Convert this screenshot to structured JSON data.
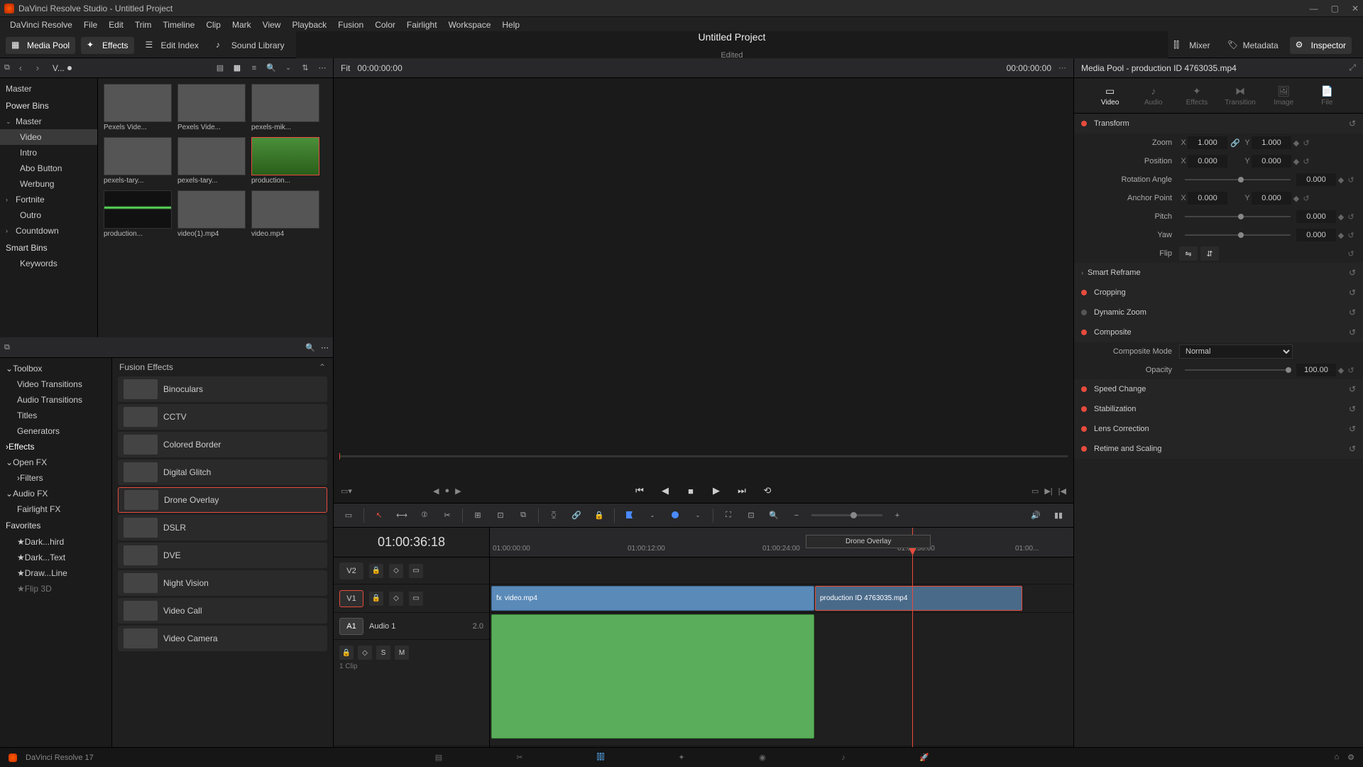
{
  "window": {
    "title": "DaVinci Resolve Studio - Untitled Project"
  },
  "menu": [
    "DaVinci Resolve",
    "File",
    "Edit",
    "Trim",
    "Timeline",
    "Clip",
    "Mark",
    "View",
    "Playback",
    "Fusion",
    "Color",
    "Fairlight",
    "Workspace",
    "Help"
  ],
  "toolbar": {
    "media_pool": "Media Pool",
    "effects": "Effects",
    "edit_index": "Edit Index",
    "sound_library": "Sound Library",
    "project_title": "Untitled Project",
    "edited_badge": "Edited",
    "mixer": "Mixer",
    "metadata": "Metadata",
    "inspector": "Inspector"
  },
  "media_pool": {
    "fit_label": "Fit",
    "viewer_tc": "00:00:00:00",
    "right_tc": "00:00:00:00",
    "selector": "V...",
    "tree": {
      "master": "Master",
      "power_bins": "Power Bins",
      "pb_master": "Master",
      "pb_video": "Video",
      "pb_intro": "Intro",
      "pb_abo": "Abo Button",
      "pb_werbung": "Werbung",
      "pb_fortnite": "Fortnite",
      "pb_outro": "Outro",
      "pb_countdown": "Countdown",
      "smart_bins": "Smart Bins",
      "sb_keywords": "Keywords"
    },
    "clips": [
      {
        "label": "Pexels Vide..."
      },
      {
        "label": "Pexels Vide..."
      },
      {
        "label": "pexels-mik..."
      },
      {
        "label": "pexels-tary..."
      },
      {
        "label": "pexels-tary..."
      },
      {
        "label": "production..."
      },
      {
        "label": "production..."
      },
      {
        "label": "video(1).mp4"
      },
      {
        "label": "video.mp4"
      }
    ]
  },
  "effects": {
    "tree": {
      "toolbox": "Toolbox",
      "vt": "Video Transitions",
      "at": "Audio Transitions",
      "titles": "Titles",
      "generators": "Generators",
      "effects": "Effects",
      "openfx": "Open FX",
      "filters": "Filters",
      "audiofx": "Audio FX",
      "fairlightfx": "Fairlight FX",
      "favorites": "Favorites",
      "fav1": "Dark...hird",
      "fav2": "Dark...Text",
      "fav3": "Draw...Line",
      "fav4": "Flip 3D"
    },
    "category": "Fusion Effects",
    "items": [
      "Binoculars",
      "CCTV",
      "Colored Border",
      "Digital Glitch",
      "Drone Overlay",
      "DSLR",
      "DVE",
      "Night Vision",
      "Video Call",
      "Video Camera"
    ]
  },
  "timeline": {
    "tc": "01:00:36:18",
    "ruler": [
      "01:00:00:00",
      "01:00:12:00",
      "01:00:24:00",
      "01:00:36:00",
      "01:00..."
    ],
    "tracks": {
      "v2": "V2",
      "v1": "V1",
      "a1": "A1",
      "audio1": "Audio 1",
      "clipcount": "1 Clip",
      "gain": "2.0"
    },
    "clips": {
      "video1": "video.mp4",
      "video2": "production ID 4763035.mp4"
    },
    "drag_ghost": "Drone Overlay"
  },
  "inspector": {
    "header": "Media Pool - production ID 4763035.mp4",
    "tabs": {
      "video": "Video",
      "audio": "Audio",
      "effects": "Effects",
      "transition": "Transition",
      "image": "Image",
      "file": "File"
    },
    "transform": {
      "title": "Transform",
      "zoom_label": "Zoom",
      "zoom_x": "1.000",
      "zoom_y": "1.000",
      "pos_label": "Position",
      "pos_x": "0.000",
      "pos_y": "0.000",
      "rot_label": "Rotation Angle",
      "rot": "0.000",
      "anchor_label": "Anchor Point",
      "anchor_x": "0.000",
      "anchor_y": "0.000",
      "pitch_label": "Pitch",
      "pitch": "0.000",
      "yaw_label": "Yaw",
      "yaw": "0.000",
      "flip_label": "Flip"
    },
    "sections": {
      "smart_reframe": "Smart Reframe",
      "cropping": "Cropping",
      "dynamic_zoom": "Dynamic Zoom",
      "composite": "Composite",
      "composite_mode_label": "Composite Mode",
      "composite_mode": "Normal",
      "opacity_label": "Opacity",
      "opacity": "100.00",
      "speed": "Speed Change",
      "stabilization": "Stabilization",
      "lens": "Lens Correction",
      "retime": "Retime and Scaling"
    }
  },
  "footer": {
    "version": "DaVinci Resolve 17"
  }
}
